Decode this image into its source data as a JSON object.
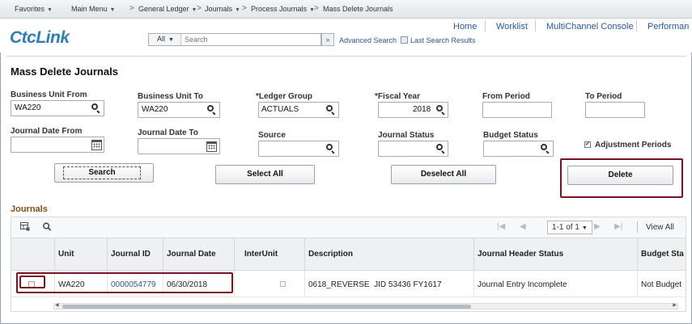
{
  "breadcrumb": {
    "favorites": "Favorites",
    "main_menu": "Main Menu",
    "general_ledger": "General Ledger",
    "journals": "Journals",
    "process_journals": "Process Journals",
    "current": "Mass Delete Journals",
    "separator": ">"
  },
  "header": {
    "links": [
      "Home",
      "Worklist",
      "MultiChannel Console",
      "Performan"
    ],
    "logo": {
      "pre": "",
      "o": "C",
      "post": "tcLink"
    },
    "search": {
      "scope": "All",
      "placeholder": "Search",
      "advanced": "Advanced Search",
      "last_results": "Last Search Results"
    }
  },
  "page": {
    "title": "Mass Delete Journals"
  },
  "filters": {
    "business_unit_from": {
      "label": "Business Unit From",
      "value": "WA220"
    },
    "business_unit_to": {
      "label": "Business Unit To",
      "value": "WA220"
    },
    "ledger_group": {
      "label": "*Ledger Group",
      "value": "ACTUALS"
    },
    "fiscal_year": {
      "label": "*Fiscal Year",
      "value": "2018"
    },
    "from_period": {
      "label": "From Period",
      "value": ""
    },
    "to_period": {
      "label": "To Period",
      "value": ""
    },
    "journal_date_from": {
      "label": "Journal Date From",
      "value": ""
    },
    "journal_date_to": {
      "label": "Journal Date To",
      "value": ""
    },
    "source": {
      "label": "Source",
      "value": ""
    },
    "journal_status": {
      "label": "Journal Status",
      "value": ""
    },
    "budget_status": {
      "label": "Budget Status",
      "value": ""
    },
    "adjustment_periods": {
      "label": "Adjustment Periods",
      "checked": true,
      "mark": "✔"
    }
  },
  "buttons": {
    "search": "Search",
    "select_all": "Select All",
    "deselect_all": "Deselect All",
    "delete": "Delete"
  },
  "journals": {
    "title": "Journals",
    "pager": {
      "text": "1-1 of 1",
      "view_all": "View All",
      "first": "|◀",
      "prev": "◀",
      "next": "▶",
      "last": "▶|"
    },
    "columns": [
      "Unit",
      "Journal ID",
      "Journal Date",
      "InterUnit",
      "Description",
      "Journal Header Status",
      "Budget Sta"
    ],
    "rows": [
      {
        "selected": false,
        "unit": "WA220",
        "journal_id": "0000054779",
        "journal_date": "06/30/2018",
        "interunit": false,
        "description": "0618_REVERSE  JID 53436 FY1617",
        "header_status": "Journal Entry Incomplete",
        "budget_status": "Not Budget"
      }
    ]
  }
}
